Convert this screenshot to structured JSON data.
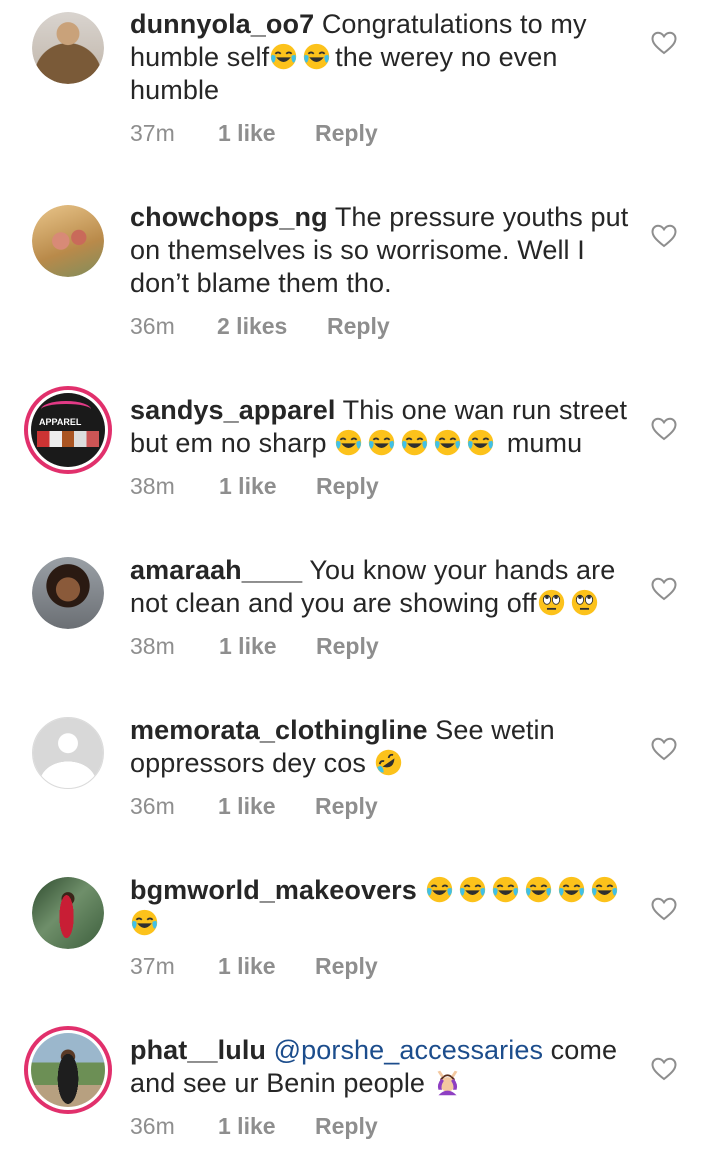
{
  "comments": [
    {
      "username": "dunnyola_oo7",
      "parts": [
        " Congratulations to my humble self",
        "",
        "",
        "the werey no even humble"
      ],
      "time": "37m",
      "likes": "1 like",
      "reply": "Reply",
      "avatar": "avatar-woman-leopard"
    },
    {
      "username": "chowchops_ng",
      "parts": [
        " The pressure youths put on themselves is so worrisome. Well I don’t blame them tho."
      ],
      "time": "36m",
      "likes": "2 likes",
      "reply": "Reply",
      "avatar": "avatar-food"
    },
    {
      "username": "sandys_apparel",
      "parts": [
        " This one wan run street but em no sharp ",
        "mumu"
      ],
      "time": "38m",
      "likes": "1 like",
      "reply": "Reply",
      "avatar": "avatar-apparel-logo",
      "avatar_text": "APPAREL"
    },
    {
      "username": "amaraah____",
      "parts": [
        " You know your hands are not clean and you are showing off"
      ],
      "time": "38m",
      "likes": "1 like",
      "reply": "Reply",
      "avatar": "avatar-woman-smiling"
    },
    {
      "username": "memorata_clothingline",
      "parts": [
        " See wetin oppressors dey cos "
      ],
      "time": "36m",
      "likes": "1 like",
      "reply": "Reply",
      "avatar": "avatar-default"
    },
    {
      "username": "bgmworld_makeovers",
      "parts": [
        ""
      ],
      "time": "37m",
      "likes": "1 like",
      "reply": "Reply",
      "avatar": "avatar-person-outdoor"
    },
    {
      "username": "phat__lulu",
      "mention": "@porshe_accessaries",
      "parts": [
        " come and see ur Benin people "
      ],
      "time": "36m",
      "likes": "1 like",
      "reply": "Reply",
      "avatar": "avatar-woman-standing"
    }
  ],
  "icons": {
    "like": "heart-outline-icon",
    "laugh": "face-with-tears-of-joy-emoji",
    "eyeroll": "face-with-rolling-eyes-emoji",
    "rofl": "rolling-on-floor-laughing-emoji",
    "facepalm": "person-raising-hands-emoji"
  },
  "colors": {
    "text": "#262626",
    "meta": "#8e8e8e",
    "mention": "#1c4d8c",
    "story_ring": "#e1306c"
  }
}
